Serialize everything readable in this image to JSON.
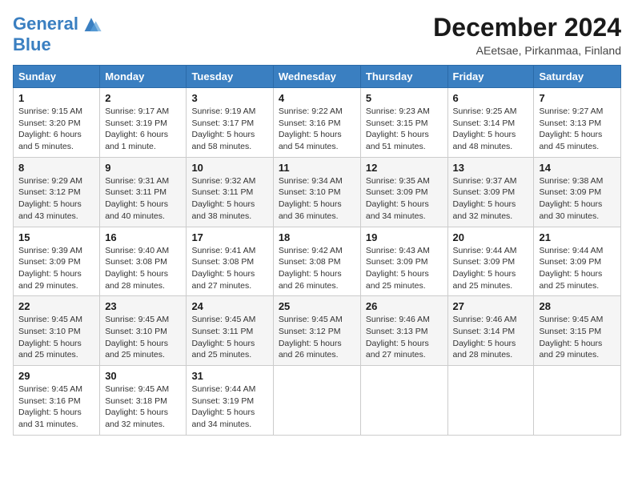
{
  "logo": {
    "line1": "General",
    "line2": "Blue"
  },
  "title": "December 2024",
  "location": "AEetsae, Pirkanmaa, Finland",
  "days_of_week": [
    "Sunday",
    "Monday",
    "Tuesday",
    "Wednesday",
    "Thursday",
    "Friday",
    "Saturday"
  ],
  "weeks": [
    [
      {
        "day": "1",
        "sunrise": "Sunrise: 9:15 AM",
        "sunset": "Sunset: 3:20 PM",
        "daylight": "Daylight: 6 hours and 5 minutes."
      },
      {
        "day": "2",
        "sunrise": "Sunrise: 9:17 AM",
        "sunset": "Sunset: 3:19 PM",
        "daylight": "Daylight: 6 hours and 1 minute."
      },
      {
        "day": "3",
        "sunrise": "Sunrise: 9:19 AM",
        "sunset": "Sunset: 3:17 PM",
        "daylight": "Daylight: 5 hours and 58 minutes."
      },
      {
        "day": "4",
        "sunrise": "Sunrise: 9:22 AM",
        "sunset": "Sunset: 3:16 PM",
        "daylight": "Daylight: 5 hours and 54 minutes."
      },
      {
        "day": "5",
        "sunrise": "Sunrise: 9:23 AM",
        "sunset": "Sunset: 3:15 PM",
        "daylight": "Daylight: 5 hours and 51 minutes."
      },
      {
        "day": "6",
        "sunrise": "Sunrise: 9:25 AM",
        "sunset": "Sunset: 3:14 PM",
        "daylight": "Daylight: 5 hours and 48 minutes."
      },
      {
        "day": "7",
        "sunrise": "Sunrise: 9:27 AM",
        "sunset": "Sunset: 3:13 PM",
        "daylight": "Daylight: 5 hours and 45 minutes."
      }
    ],
    [
      {
        "day": "8",
        "sunrise": "Sunrise: 9:29 AM",
        "sunset": "Sunset: 3:12 PM",
        "daylight": "Daylight: 5 hours and 43 minutes."
      },
      {
        "day": "9",
        "sunrise": "Sunrise: 9:31 AM",
        "sunset": "Sunset: 3:11 PM",
        "daylight": "Daylight: 5 hours and 40 minutes."
      },
      {
        "day": "10",
        "sunrise": "Sunrise: 9:32 AM",
        "sunset": "Sunset: 3:11 PM",
        "daylight": "Daylight: 5 hours and 38 minutes."
      },
      {
        "day": "11",
        "sunrise": "Sunrise: 9:34 AM",
        "sunset": "Sunset: 3:10 PM",
        "daylight": "Daylight: 5 hours and 36 minutes."
      },
      {
        "day": "12",
        "sunrise": "Sunrise: 9:35 AM",
        "sunset": "Sunset: 3:09 PM",
        "daylight": "Daylight: 5 hours and 34 minutes."
      },
      {
        "day": "13",
        "sunrise": "Sunrise: 9:37 AM",
        "sunset": "Sunset: 3:09 PM",
        "daylight": "Daylight: 5 hours and 32 minutes."
      },
      {
        "day": "14",
        "sunrise": "Sunrise: 9:38 AM",
        "sunset": "Sunset: 3:09 PM",
        "daylight": "Daylight: 5 hours and 30 minutes."
      }
    ],
    [
      {
        "day": "15",
        "sunrise": "Sunrise: 9:39 AM",
        "sunset": "Sunset: 3:09 PM",
        "daylight": "Daylight: 5 hours and 29 minutes."
      },
      {
        "day": "16",
        "sunrise": "Sunrise: 9:40 AM",
        "sunset": "Sunset: 3:08 PM",
        "daylight": "Daylight: 5 hours and 28 minutes."
      },
      {
        "day": "17",
        "sunrise": "Sunrise: 9:41 AM",
        "sunset": "Sunset: 3:08 PM",
        "daylight": "Daylight: 5 hours and 27 minutes."
      },
      {
        "day": "18",
        "sunrise": "Sunrise: 9:42 AM",
        "sunset": "Sunset: 3:08 PM",
        "daylight": "Daylight: 5 hours and 26 minutes."
      },
      {
        "day": "19",
        "sunrise": "Sunrise: 9:43 AM",
        "sunset": "Sunset: 3:09 PM",
        "daylight": "Daylight: 5 hours and 25 minutes."
      },
      {
        "day": "20",
        "sunrise": "Sunrise: 9:44 AM",
        "sunset": "Sunset: 3:09 PM",
        "daylight": "Daylight: 5 hours and 25 minutes."
      },
      {
        "day": "21",
        "sunrise": "Sunrise: 9:44 AM",
        "sunset": "Sunset: 3:09 PM",
        "daylight": "Daylight: 5 hours and 25 minutes."
      }
    ],
    [
      {
        "day": "22",
        "sunrise": "Sunrise: 9:45 AM",
        "sunset": "Sunset: 3:10 PM",
        "daylight": "Daylight: 5 hours and 25 minutes."
      },
      {
        "day": "23",
        "sunrise": "Sunrise: 9:45 AM",
        "sunset": "Sunset: 3:10 PM",
        "daylight": "Daylight: 5 hours and 25 minutes."
      },
      {
        "day": "24",
        "sunrise": "Sunrise: 9:45 AM",
        "sunset": "Sunset: 3:11 PM",
        "daylight": "Daylight: 5 hours and 25 minutes."
      },
      {
        "day": "25",
        "sunrise": "Sunrise: 9:45 AM",
        "sunset": "Sunset: 3:12 PM",
        "daylight": "Daylight: 5 hours and 26 minutes."
      },
      {
        "day": "26",
        "sunrise": "Sunrise: 9:46 AM",
        "sunset": "Sunset: 3:13 PM",
        "daylight": "Daylight: 5 hours and 27 minutes."
      },
      {
        "day": "27",
        "sunrise": "Sunrise: 9:46 AM",
        "sunset": "Sunset: 3:14 PM",
        "daylight": "Daylight: 5 hours and 28 minutes."
      },
      {
        "day": "28",
        "sunrise": "Sunrise: 9:45 AM",
        "sunset": "Sunset: 3:15 PM",
        "daylight": "Daylight: 5 hours and 29 minutes."
      }
    ],
    [
      {
        "day": "29",
        "sunrise": "Sunrise: 9:45 AM",
        "sunset": "Sunset: 3:16 PM",
        "daylight": "Daylight: 5 hours and 31 minutes."
      },
      {
        "day": "30",
        "sunrise": "Sunrise: 9:45 AM",
        "sunset": "Sunset: 3:18 PM",
        "daylight": "Daylight: 5 hours and 32 minutes."
      },
      {
        "day": "31",
        "sunrise": "Sunrise: 9:44 AM",
        "sunset": "Sunset: 3:19 PM",
        "daylight": "Daylight: 5 hours and 34 minutes."
      },
      null,
      null,
      null,
      null
    ]
  ]
}
